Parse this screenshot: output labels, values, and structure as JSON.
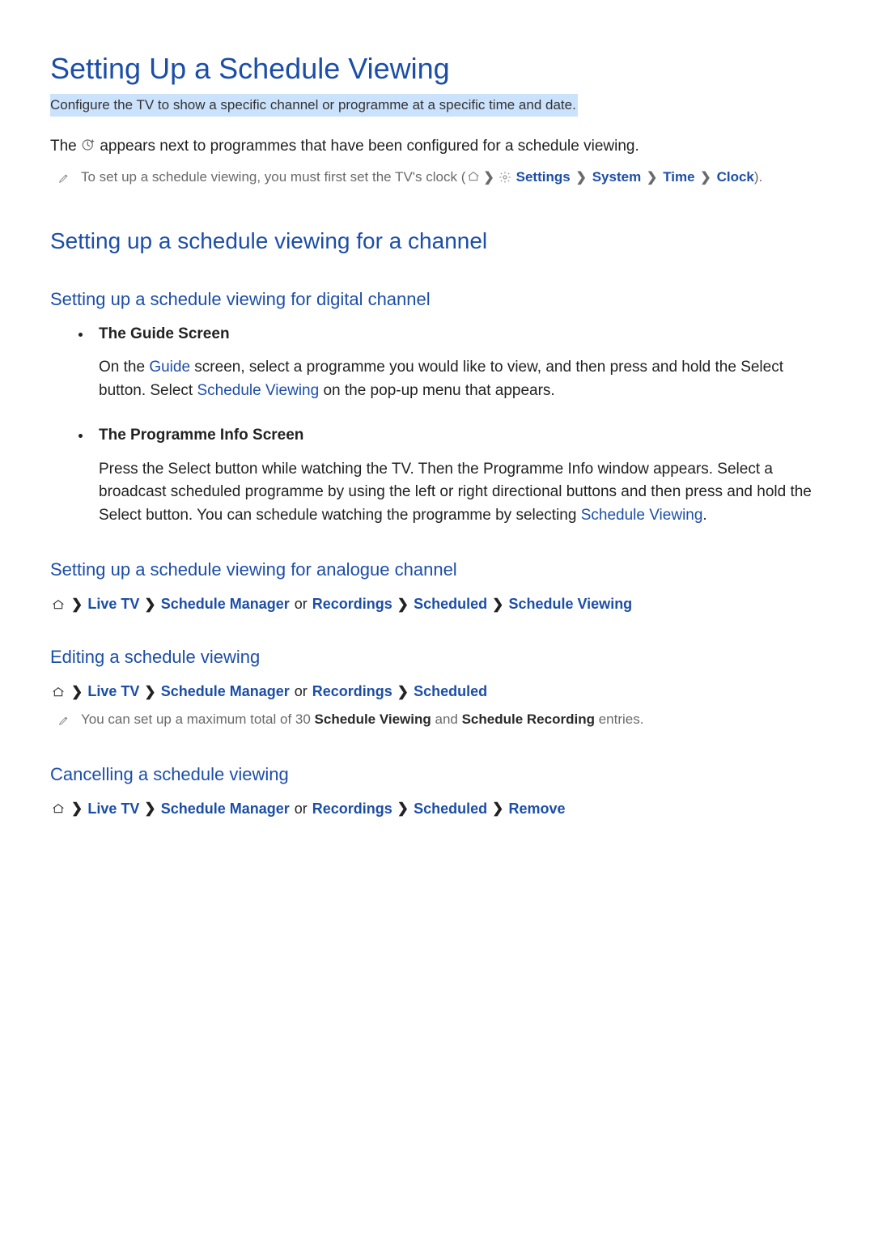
{
  "pageTitle": "Setting Up a Schedule Viewing",
  "subtitle": "Configure the TV to show a specific channel or programme at a specific time and date.",
  "intro": {
    "prefix": "The ",
    "suffix": " appears next to programmes that have been configured for a schedule viewing."
  },
  "clockNote": {
    "lead": "To set up a schedule viewing, you must first set the TV's clock (",
    "settings": "Settings",
    "system": "System",
    "time": "Time",
    "clock": "Clock",
    "close": ")."
  },
  "section1": {
    "heading": "Setting up a schedule viewing for a channel",
    "digital": {
      "heading": "Setting up a schedule viewing for digital channel",
      "guideTitle": "The Guide Screen",
      "guideBody1": "On the ",
      "guideLink": "Guide",
      "guideBody2": " screen, select a programme you would like to view, and then press and hold the Select button. Select ",
      "guideLink2": "Schedule Viewing",
      "guideBody3": " on the pop-up menu that appears.",
      "progTitle": "The Programme Info Screen",
      "progBody1": "Press the Select button while watching the TV. Then the Programme Info window appears. Select a broadcast scheduled programme by using the left or right directional buttons and then press and hold the Select button. You can schedule watching the programme by selecting ",
      "progLink": "Schedule Viewing",
      "progBody2": "."
    },
    "analogue": {
      "heading": "Setting up a schedule viewing for analogue channel",
      "c": {
        "live": "Live TV",
        "sm": "Schedule Manager",
        "or": "or",
        "rec": "Recordings",
        "sch": "Scheduled",
        "sv": "Schedule Viewing"
      }
    },
    "edit": {
      "heading": "Editing a schedule viewing",
      "c": {
        "live": "Live TV",
        "sm": "Schedule Manager",
        "or": "or",
        "rec": "Recordings",
        "sch": "Scheduled"
      },
      "note1": "You can set up a maximum total of 30 ",
      "noteL1": "Schedule Viewing",
      "note2": " and ",
      "noteL2": "Schedule Recording",
      "note3": " entries."
    },
    "cancel": {
      "heading": "Cancelling a schedule viewing",
      "c": {
        "live": "Live TV",
        "sm": "Schedule Manager",
        "or": "or",
        "rec": "Recordings",
        "sch": "Scheduled",
        "del": "Remove"
      }
    }
  }
}
